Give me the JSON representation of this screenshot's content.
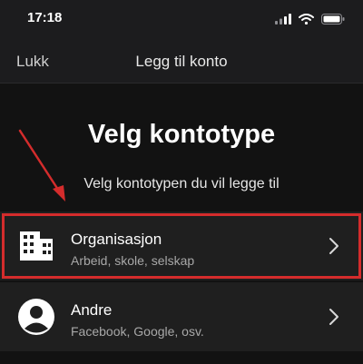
{
  "status_bar": {
    "time": "17:18",
    "icons": [
      "signal-icon",
      "wifi-icon",
      "battery-icon"
    ]
  },
  "nav": {
    "close_label": "Lukk",
    "title": "Legg til konto"
  },
  "main": {
    "heading": "Velg kontotype",
    "subheading": "Velg kontotypen du vil legge til",
    "options": [
      {
        "title": "Organisasjon",
        "subtitle": "Arbeid, skole, selskap",
        "icon": "building-icon",
        "highlighted": true
      },
      {
        "title": "Andre",
        "subtitle": "Facebook, Google, osv.",
        "icon": "person-icon",
        "highlighted": false
      }
    ]
  },
  "colors": {
    "background": "#121212",
    "bar": "#1c1c1e",
    "option_background": "#1f1f1f",
    "highlight": "#d42c2c",
    "annotation_arrow": "#d42c2c"
  }
}
